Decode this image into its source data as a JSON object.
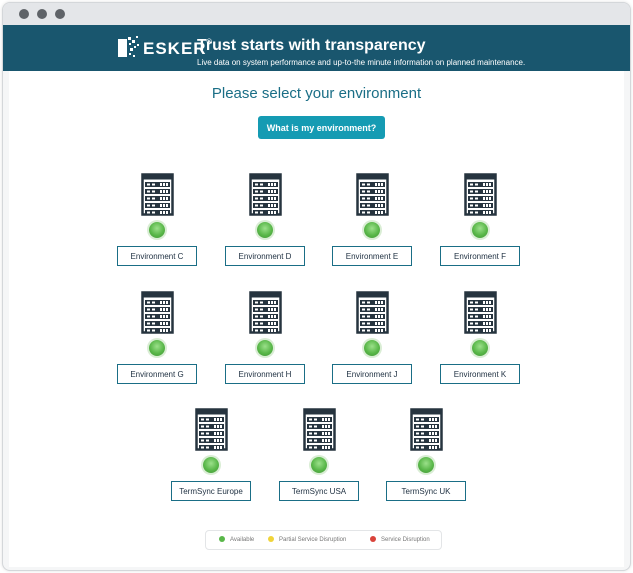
{
  "banner": {
    "logo_text": "ESKER",
    "logo_reg": "®",
    "title": "Trust starts with transparency",
    "subtitle": "Live data on system performance and up-to-the minute information on planned maintenance."
  },
  "main": {
    "headline": "Please select your environment",
    "help_button": "What is my environment?"
  },
  "environments": [
    {
      "label": "Environment C",
      "status": "available"
    },
    {
      "label": "Environment D",
      "status": "available"
    },
    {
      "label": "Environment E",
      "status": "available"
    },
    {
      "label": "Environment F",
      "status": "available"
    },
    {
      "label": "Environment G",
      "status": "available"
    },
    {
      "label": "Environment H",
      "status": "available"
    },
    {
      "label": "Environment J",
      "status": "available"
    },
    {
      "label": "Environment K",
      "status": "available"
    },
    {
      "label": "TermSync Europe",
      "status": "available"
    },
    {
      "label": "TermSync USA",
      "status": "available"
    },
    {
      "label": "TermSync UK",
      "status": "available"
    }
  ],
  "legend": {
    "available": "Available",
    "partial": "Partial Service Disruption",
    "disruption": "Service Disruption"
  },
  "colors": {
    "banner": "#19566e",
    "accent": "#159bb3",
    "available": "#59b749",
    "partial": "#f0d43a",
    "disruption": "#d9433b"
  }
}
